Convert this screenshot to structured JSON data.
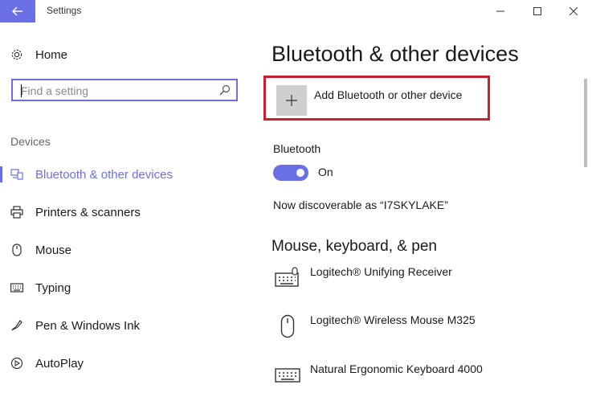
{
  "window": {
    "title": "Settings"
  },
  "sidebar": {
    "home_label": "Home",
    "search": {
      "placeholder": "Find a setting"
    },
    "section_label": "Devices",
    "items": [
      {
        "label": "Bluetooth & other devices",
        "icon": "bluetooth-devices-icon",
        "selected": true
      },
      {
        "label": "Printers & scanners",
        "icon": "printer-icon",
        "selected": false
      },
      {
        "label": "Mouse",
        "icon": "mouse-icon",
        "selected": false
      },
      {
        "label": "Typing",
        "icon": "keyboard-icon",
        "selected": false
      },
      {
        "label": "Pen & Windows Ink",
        "icon": "pen-icon",
        "selected": false
      },
      {
        "label": "AutoPlay",
        "icon": "autoplay-icon",
        "selected": false
      }
    ]
  },
  "main": {
    "title": "Bluetooth & other devices",
    "add_device_label": "Add Bluetooth or other device",
    "bluetooth": {
      "heading": "Bluetooth",
      "toggle_state": "On",
      "discoverable_text": "Now discoverable as “I7SKYLAKE”"
    },
    "devices_section_title": "Mouse, keyboard, & pen",
    "devices": [
      {
        "name": "Logitech® Unifying Receiver",
        "icon": "keyboard-receiver-icon"
      },
      {
        "name": "Logitech® Wireless Mouse M325",
        "icon": "mouse-icon"
      },
      {
        "name": "Natural Ergonomic Keyboard 4000",
        "icon": "keyboard-icon"
      }
    ]
  },
  "colors": {
    "accent": "#6b6fe6",
    "highlight_border": "#c8202e"
  }
}
